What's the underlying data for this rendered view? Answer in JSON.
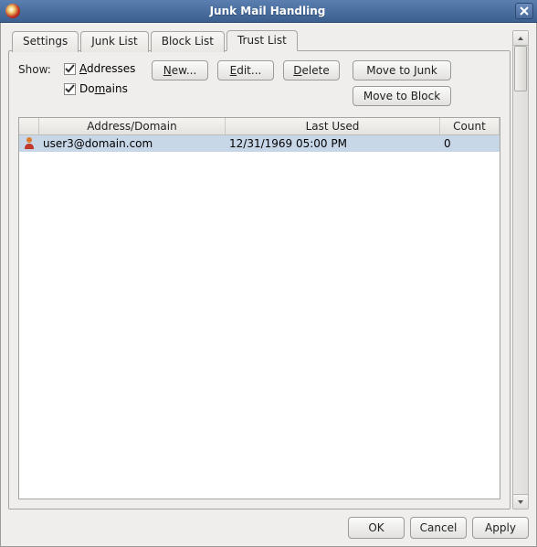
{
  "window": {
    "title": "Junk Mail Handling"
  },
  "tabs": [
    {
      "label": "Settings"
    },
    {
      "label": "Junk List"
    },
    {
      "label": "Block List"
    },
    {
      "label": "Trust List"
    }
  ],
  "active_tab_index": 3,
  "trust_panel": {
    "show_label": "Show:",
    "checkboxes": {
      "addresses": {
        "label_pre": "",
        "label_accel": "A",
        "label_post": "ddresses",
        "checked": true
      },
      "domains": {
        "label_pre": "Do",
        "label_accel": "m",
        "label_post": "ains",
        "checked": true
      }
    },
    "buttons": {
      "new": {
        "accel": "N",
        "post": "ew..."
      },
      "edit": {
        "accel": "E",
        "post": "dit..."
      },
      "delete": {
        "accel": "D",
        "post": "elete"
      },
      "move_to_junk": "Move to Junk",
      "move_to_block": "Move to Block"
    },
    "table": {
      "headers": {
        "address": "Address/Domain",
        "last_used": "Last Used",
        "count": "Count"
      },
      "rows": [
        {
          "address": "user3@domain.com",
          "last_used": "12/31/1969 05:00 PM",
          "count": "0",
          "selected": true
        }
      ]
    }
  },
  "footer": {
    "ok": "OK",
    "cancel": "Cancel",
    "apply": "Apply"
  }
}
